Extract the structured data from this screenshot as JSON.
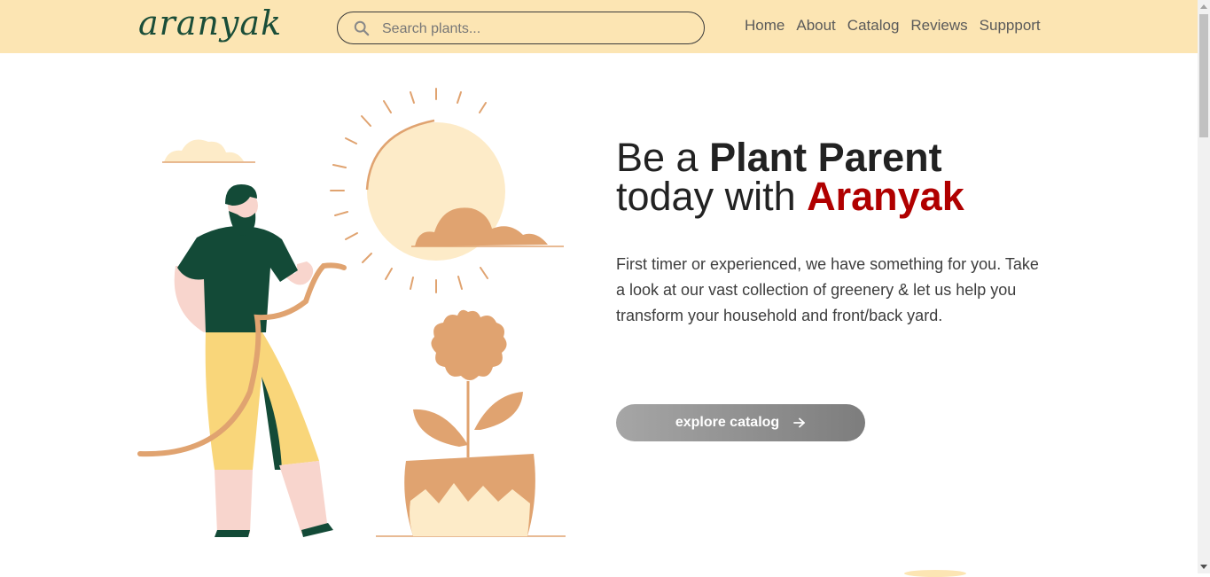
{
  "header": {
    "logo_text": "aranyak",
    "search": {
      "placeholder": "Search plants...",
      "value": ""
    },
    "nav": [
      "Home",
      "About",
      "Catalog",
      "Reviews",
      "Suppport"
    ]
  },
  "hero": {
    "headline_part1": "Be a ",
    "headline_bold": "Plant Parent",
    "headline_part2": "today with ",
    "headline_brand": "Aranyak",
    "description": "First timer or experienced, we have something for you. Take a look at our vast collection of greenery & let us help you transform your household and front/back yard.",
    "cta_label": "explore catalog",
    "cta_icon": "arrow-right-icon"
  },
  "colors": {
    "navbar_bg": "#fce5b3",
    "brand_red": "#b00000",
    "logo_green": "#1a4d38",
    "illustration_tan": "#e0a370",
    "illustration_cream": "#fdebc8",
    "illustration_green": "#134a37"
  }
}
